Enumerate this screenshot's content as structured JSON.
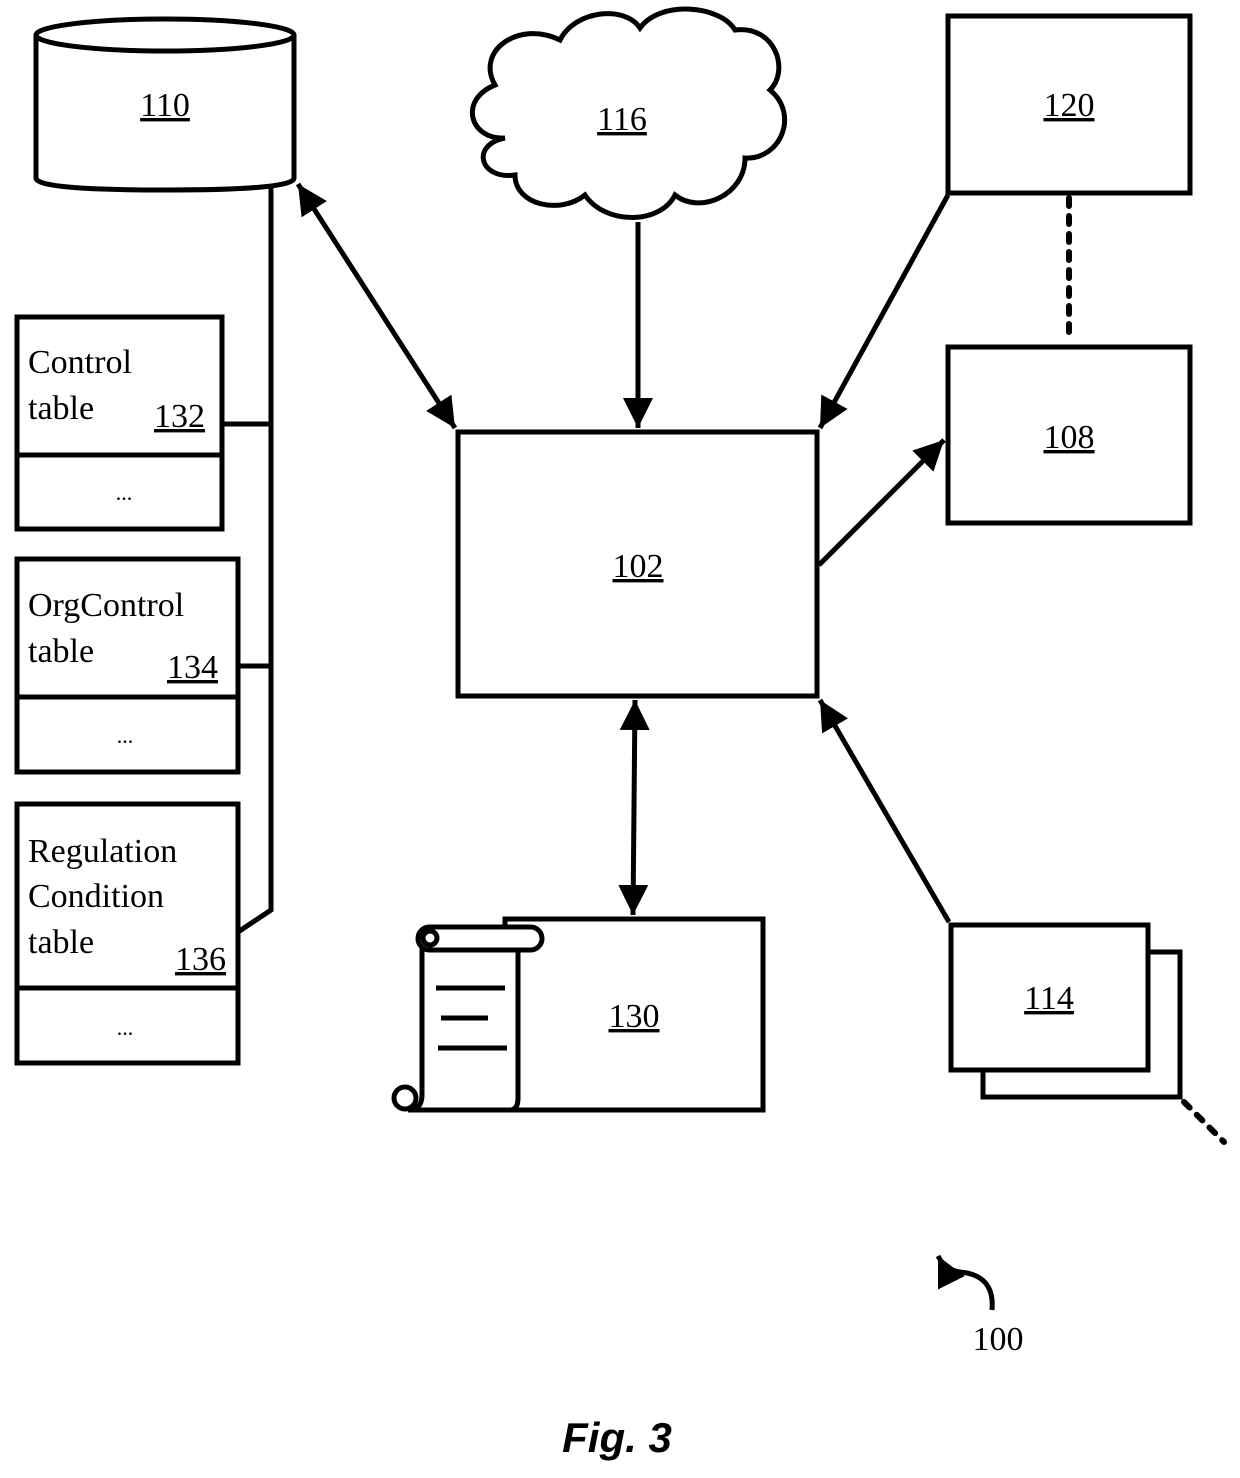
{
  "figure": {
    "caption": "Fig. 3",
    "system_ref": "100"
  },
  "nodes": {
    "database": {
      "ref": "110",
      "shape": "cylinder"
    },
    "cloud": {
      "ref": "116",
      "shape": "cloud"
    },
    "box_120": {
      "ref": "120",
      "shape": "rectangle"
    },
    "box_108": {
      "ref": "108",
      "shape": "rectangle"
    },
    "box_102": {
      "ref": "102",
      "shape": "rectangle"
    },
    "box_130": {
      "ref": "130",
      "shape": "document-scroll"
    },
    "box_114": {
      "ref": "114",
      "shape": "stacked-rectangles"
    }
  },
  "tables": [
    {
      "line1": "Control",
      "line2": "table",
      "line3": "",
      "ref": "132",
      "row_placeholder": "..."
    },
    {
      "line1": "OrgControl",
      "line2": "table",
      "line3": "",
      "ref": "134",
      "row_placeholder": "..."
    },
    {
      "line1": "Regulation",
      "line2": "Condition",
      "line3": "table",
      "ref": "136",
      "row_placeholder": "..."
    }
  ],
  "connections": [
    {
      "from": "110",
      "to": "102",
      "type": "bidirectional-arrow"
    },
    {
      "from": "116",
      "to": "102",
      "type": "arrow"
    },
    {
      "from": "120",
      "to": "102",
      "type": "arrow"
    },
    {
      "from": "120",
      "to": "108",
      "type": "dashed-line"
    },
    {
      "from": "102",
      "to": "108",
      "type": "arrow"
    },
    {
      "from": "102",
      "to": "130",
      "type": "bidirectional-arrow"
    },
    {
      "from": "114",
      "to": "102",
      "type": "arrow"
    },
    {
      "from": "110",
      "to": "132",
      "type": "line"
    },
    {
      "from": "110",
      "to": "134",
      "type": "line"
    },
    {
      "from": "110",
      "to": "136",
      "type": "line"
    }
  ]
}
